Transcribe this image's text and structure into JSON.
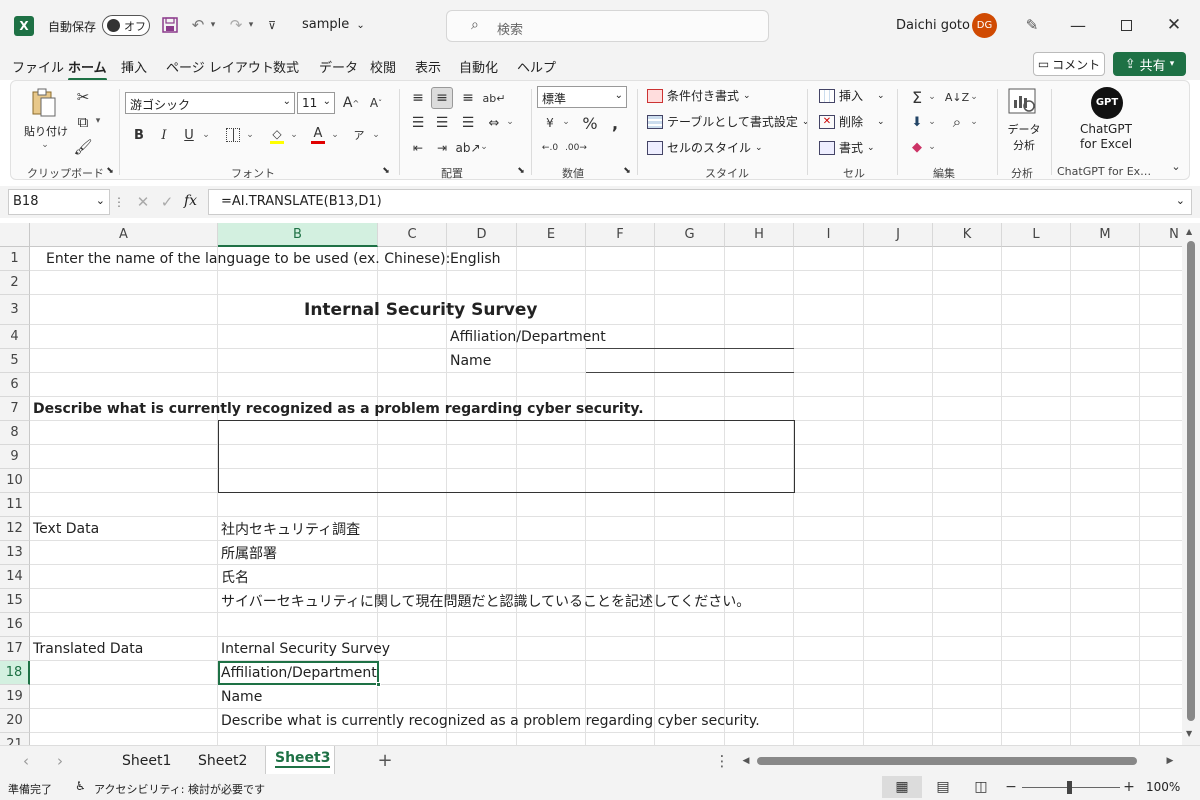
{
  "window": {
    "autosave_label": "自動保存",
    "autosave_state": "オフ",
    "filename": "sample",
    "search_placeholder": "検索",
    "user_name": "Daichi goto",
    "user_initials": "DG",
    "accent_color": "#1e7145",
    "avatar_color": "#d04a02"
  },
  "menu_tabs": [
    "ファイル",
    "ホーム",
    "挿入",
    "ページ レイアウト",
    "数式",
    "データ",
    "校閲",
    "表示",
    "自動化",
    "ヘルプ"
  ],
  "active_tab": "ホーム",
  "header_actions": {
    "comment": "コメント",
    "share": "共有"
  },
  "ribbon": {
    "clipboard": {
      "paste": "貼り付け",
      "label": "クリップボード"
    },
    "font": {
      "name": "游ゴシック",
      "size": "11",
      "label": "フォント"
    },
    "alignment": {
      "label": "配置"
    },
    "number": {
      "format": "標準",
      "label": "数値"
    },
    "styles": {
      "conditional": "条件付き書式",
      "table": "テーブルとして書式設定",
      "cell_styles": "セルのスタイル",
      "label": "スタイル"
    },
    "cells": {
      "insert": "挿入",
      "delete": "削除",
      "format": "書式",
      "label": "セル"
    },
    "editing": {
      "label": "編集"
    },
    "analysis": {
      "button": "データ\n分析",
      "label": "分析"
    },
    "chatgpt": {
      "logo": "GPT",
      "button_line1": "ChatGPT",
      "button_line2": "for Excel",
      "label": "ChatGPT for Ex…"
    }
  },
  "formula_bar": {
    "name_box": "B18",
    "formula": "=AI.TRANSLATE(B13,D1)",
    "fx": "fx"
  },
  "columns": [
    "A",
    "B",
    "C",
    "D",
    "E",
    "F",
    "G",
    "H",
    "I",
    "J",
    "K",
    "L",
    "M",
    "N"
  ],
  "selected_column": "B",
  "rows": [
    "1",
    "2",
    "3",
    "4",
    "5",
    "6",
    "7",
    "8",
    "9",
    "10",
    "11",
    "12",
    "13",
    "14",
    "15",
    "16",
    "17",
    "18",
    "19",
    "20",
    "21"
  ],
  "selected_row": "18",
  "cells": {
    "A1": "Enter the name of the language to be used (ex. Chinese):",
    "D1": "English",
    "B3": "Internal Security Survey",
    "D4": "Affiliation/Department",
    "D5": "Name",
    "A7": "Describe what is currently recognized as a problem regarding cyber security.",
    "A12": "Text Data",
    "B12": "社内セキュリティ調査",
    "B13": "所属部署",
    "B14": "氏名",
    "B15": "サイバーセキュリティに関して現在問題だと認識していることを記述してください。",
    "A17": "Translated Data",
    "B17": "Internal Security Survey",
    "B18": "Affiliation/Department",
    "B19": "Name",
    "B20": "Describe what is currently recognized as a problem regarding cyber security."
  },
  "sheets": [
    "Sheet1",
    "Sheet2",
    "Sheet3"
  ],
  "active_sheet": "Sheet3",
  "status": {
    "ready": "準備完了",
    "accessibility": "アクセシビリティ: 検討が必要です",
    "zoom": "100%"
  }
}
